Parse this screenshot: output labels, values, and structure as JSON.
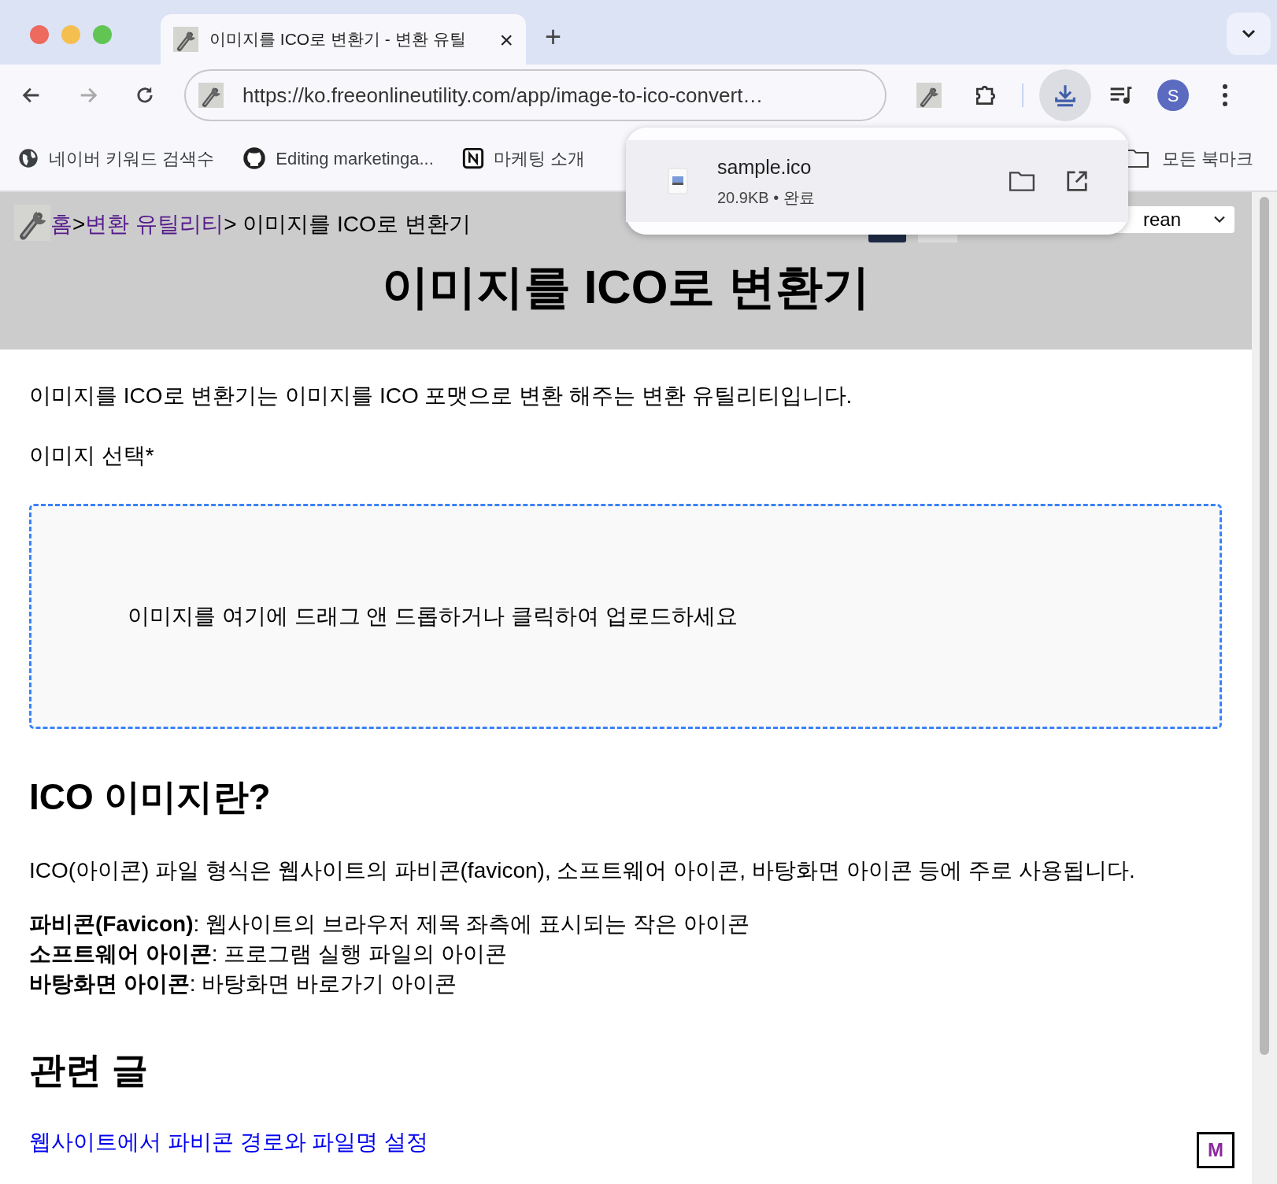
{
  "tabs": [
    {
      "title": "이미지를 ICO로 변환기 - 변환 유틸",
      "selected": true,
      "close": "×"
    }
  ],
  "new_tab": "+",
  "address_bar": {
    "url": "https://ko.freeonlineutility.com/app/image-to-ico-convert…"
  },
  "profile": {
    "initial": "S"
  },
  "bookmarks": [
    {
      "label": "네이버 키워드 검색수",
      "kind": "globe"
    },
    {
      "label": "Editing marketinga...",
      "kind": "github"
    },
    {
      "label": "마케팅 소개",
      "kind": "notion"
    }
  ],
  "all_bookmarks": "모든 북마크",
  "download_popup": {
    "file": "sample.ico",
    "size": "20.9KB",
    "separator": "•",
    "status": "완료"
  },
  "breadcrumb": {
    "links": [
      "홈",
      "변환 유틸리티"
    ],
    "separator": ">",
    "current": "> 이미지를 ICO로 변환기"
  },
  "language_select": {
    "value": "rean"
  },
  "page_title": "이미지를 ICO로 변환기",
  "intro": "이미지를 ICO로 변환기는 이미지를 ICO 포맷으로 변환 해주는 변환 유틸리티입니다.",
  "image_label": "이미지 선택*",
  "dropzone": {
    "text": "이미지를 여기에 드래그 앤 드롭하거나 클릭하여 업로드하세요"
  },
  "section_heading": "ICO 이미지란?",
  "description": "ICO(아이콘) 파일 형식은 웹사이트의 파비콘(favicon), 소프트웨어 아이콘, 바탕화면 아이콘 등에 주로 사용됩니다.",
  "definitions": [
    {
      "term": "파비콘(Favicon)",
      "text": ": 웹사이트의 브라우저 제목 좌측에 표시되는 작은 아이콘"
    },
    {
      "term": "소프트웨어 아이콘",
      "text": ": 프로그램 실행 파일의 아이콘"
    },
    {
      "term": "바탕화면 아이콘",
      "text": ": 바탕화면 바로가기 아이콘"
    }
  ],
  "related_heading": "관련 글",
  "related_links": [
    "웹사이트에서 파비콘 경로와 파일명 설정"
  ],
  "corner_logo": "M"
}
